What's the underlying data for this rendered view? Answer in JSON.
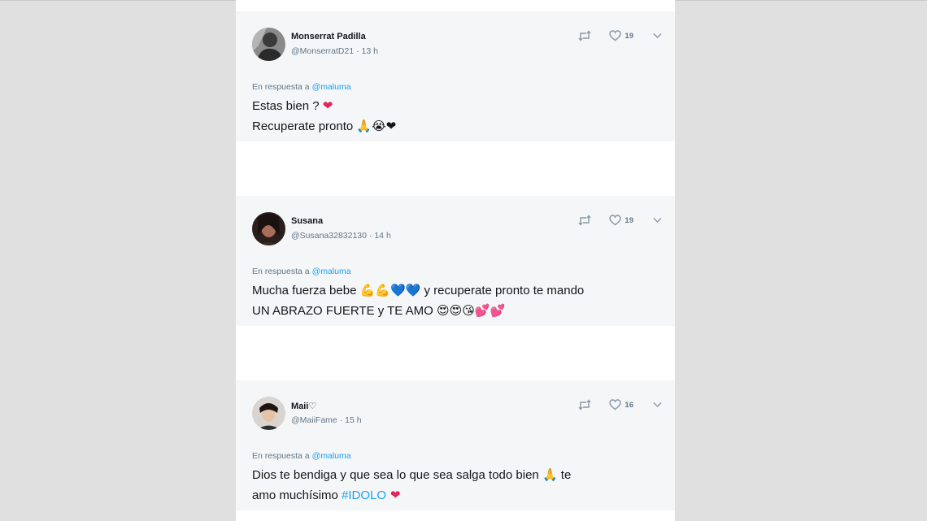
{
  "tweets": [
    {
      "name": "Monserrat Padilla",
      "handle": "@MonserratD21",
      "time": "13 h",
      "reply_prefix": "En respuesta a",
      "reply_handle": "@maluma",
      "likes": "19",
      "body_line1_text": "Estas bien ? ",
      "body_line1_emoji": "❤",
      "body_line2_text": "Recuperate pronto ",
      "body_line2_emoji": "🙏😭❤"
    },
    {
      "name": "Susana",
      "handle": "@Susana32832130",
      "time": "14 h",
      "reply_prefix": "En respuesta a",
      "reply_handle": "@maluma",
      "likes": "19",
      "body_line1_text": "Mucha fuerza bebe ",
      "body_line1_emoji": "💪💪💙💙",
      "body_line1_rest": " y recuperate pronto te mando",
      "body_line2_text": "UN ABRAZO FUERTE y TE AMO ",
      "body_line2_emoji": "😍😍😘💕💕"
    },
    {
      "name": "Maii♡",
      "handle": "@MaiiFame",
      "time": "15 h",
      "reply_prefix": "En respuesta a",
      "reply_handle": "@maluma",
      "likes": "16",
      "body_line1_text": "Dios te bendiga y que sea lo que sea salga todo bien ",
      "body_line1_emoji": "🙏",
      "body_line1_rest": " te",
      "body_line2_text": "amo muchísimo ",
      "body_line2_hashtag": "#IDOLO",
      "body_line2_emoji": " ❤"
    }
  ],
  "colors": {
    "page_bg": "#e0e0e0",
    "card_bg": "#f4f6f8",
    "link": "#1da1f2",
    "muted": "#657786",
    "heart_emoji": "#e0245e"
  },
  "icons": [
    "retweet-icon",
    "heart-icon",
    "chevron-down-icon"
  ]
}
